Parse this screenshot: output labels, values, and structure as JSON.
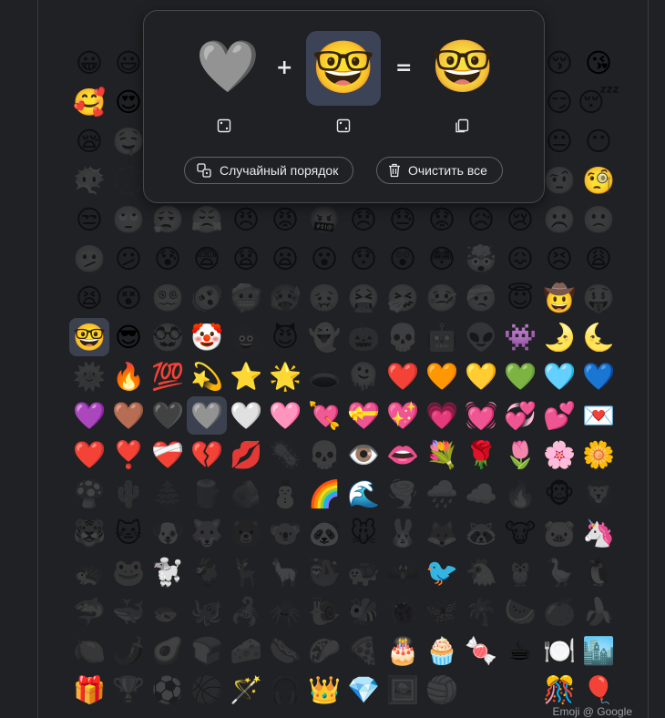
{
  "mixer": {
    "left_emoji": "🩶",
    "right_emoji": "🤓",
    "result_emoji": "🤓",
    "plus": "+",
    "equals": "=",
    "random_order_label": "Случайный порядок",
    "clear_all_label": "Очистить все"
  },
  "credit": "Emoji @ Google",
  "grid": {
    "rows": [
      [
        "😀",
        "😃",
        "😄",
        "😁",
        "😆",
        "😅",
        "😂",
        "🤣",
        "😭",
        "😉",
        "😗",
        "😙",
        "😚",
        "😘"
      ],
      [
        "🥰",
        "😍",
        "🤩",
        "🥳",
        "🫠",
        "🙃",
        "🙂",
        "🥲",
        "🥹",
        "😊",
        "☺️",
        "😌",
        "😏",
        "😴"
      ],
      [
        "😪",
        "🤤",
        "😋",
        "😛",
        "😝",
        "😜",
        "🤪",
        "🥴",
        "😔",
        "🥺",
        "😬",
        "😑",
        "😐",
        "😶"
      ],
      [
        "😶‍🌫️",
        "🫥",
        "🤐",
        "🫡",
        "🤔",
        "🤫",
        "🫢",
        "🤭",
        "🥱",
        "🤗",
        "🫣",
        "😱",
        "🤨",
        "🧐"
      ],
      [
        "😒",
        "🙄",
        "😮‍💨",
        "😤",
        "😠",
        "😡",
        "🤬",
        "😞",
        "😓",
        "😟",
        "😥",
        "😢",
        "☹️",
        "🙁"
      ],
      [
        "🫤",
        "😕",
        "😰",
        "😨",
        "😧",
        "😦",
        "😮",
        "😯",
        "😲",
        "😳",
        "🤯",
        "😖",
        "😣",
        "😩"
      ],
      [
        "😫",
        "😵",
        "😵‍💫",
        "🫨",
        "🥶",
        "🥵",
        "🤢",
        "🤮",
        "🤧",
        "🤒",
        "🤕",
        "😇",
        "🤠",
        "🤑"
      ],
      [
        "🤓",
        "😎",
        "🥸",
        "🤡",
        "💩",
        "😈",
        "👻",
        "🎃",
        "💀",
        "🤖",
        "👽",
        "👾",
        "🌛",
        "🌜"
      ],
      [
        "🌞",
        "🔥",
        "💯",
        "💫",
        "⭐",
        "🌟",
        "🕳️",
        "🫠",
        "❤️",
        "🧡",
        "💛",
        "💚",
        "🩵",
        "💙"
      ],
      [
        "💜",
        "🤎",
        "🖤",
        "🩶",
        "🤍",
        "🩷",
        "💘",
        "💝",
        "💖",
        "💗",
        "💓",
        "💞",
        "💕",
        "💌"
      ],
      [
        "❤️",
        "❣️",
        "❤️‍🩹",
        "💔",
        "💋",
        "🦠",
        "💀",
        "👁️",
        "👄",
        "💐",
        "🌹",
        "🌷",
        "🌸",
        "🌼"
      ],
      [
        "🍄",
        "🌵",
        "🌲",
        "🪵",
        "🪨",
        "⛄",
        "🌈",
        "🌊",
        "🌪️",
        "🌧️",
        "☁️",
        "🔥",
        "🐵",
        "🦁"
      ],
      [
        "🐯",
        "🐱",
        "🐶",
        "🐺",
        "🐻",
        "🐨",
        "🐼",
        "🐭",
        "🐰",
        "🦊",
        "🦝",
        "🐮",
        "🐷",
        "🦄"
      ],
      [
        "🦔",
        "🐸",
        "🐩",
        "🐐",
        "🦌",
        "🦙",
        "🦥",
        "🐢",
        "🦇",
        "🐦",
        "🐔",
        "🦉",
        "🪿",
        "🐧"
      ],
      [
        "🦈",
        "🐳",
        "🐟",
        "🐙",
        "🦂",
        "🕷️",
        "🐌",
        "🐝",
        "🐞",
        "🦋",
        "🌴",
        "🍉",
        "🍊",
        "🍌"
      ],
      [
        "🍋",
        "🌶️",
        "🥑",
        "🍞",
        "🧀",
        "🌭",
        "🌮",
        "🍕",
        "🎂",
        "🧁",
        "🍬",
        "☕",
        "🍽️",
        "🏙️"
      ],
      [
        "🎁",
        "🏆",
        "⚽",
        "🏀",
        "🪄",
        "🎧",
        "👑",
        "💎",
        "🖼️",
        "🏐",
        "",
        "",
        "🎊",
        "🎈"
      ]
    ],
    "bright": [
      [
        0,
        13
      ],
      [
        1,
        0
      ],
      [
        1,
        1
      ],
      [
        3,
        13
      ],
      [
        6,
        12
      ],
      [
        7,
        0
      ],
      [
        7,
        1
      ],
      [
        7,
        3
      ],
      [
        7,
        11
      ],
      [
        7,
        12
      ],
      [
        7,
        13
      ],
      [
        8,
        1
      ],
      [
        8,
        2
      ],
      [
        8,
        3
      ],
      [
        8,
        4
      ],
      [
        8,
        5
      ],
      [
        8,
        8
      ],
      [
        8,
        9
      ],
      [
        8,
        10
      ],
      [
        8,
        11
      ],
      [
        8,
        12
      ],
      [
        8,
        13
      ],
      [
        9,
        0
      ],
      [
        9,
        1
      ],
      [
        9,
        2
      ],
      [
        9,
        3
      ],
      [
        9,
        4
      ],
      [
        9,
        5
      ],
      [
        9,
        6
      ],
      [
        9,
        7
      ],
      [
        9,
        8
      ],
      [
        9,
        9
      ],
      [
        9,
        10
      ],
      [
        9,
        11
      ],
      [
        9,
        12
      ],
      [
        9,
        13
      ],
      [
        10,
        0
      ],
      [
        10,
        1
      ],
      [
        10,
        2
      ],
      [
        10,
        3
      ],
      [
        10,
        4
      ],
      [
        10,
        7
      ],
      [
        10,
        8
      ],
      [
        10,
        9
      ],
      [
        10,
        10
      ],
      [
        10,
        11
      ],
      [
        10,
        12
      ],
      [
        10,
        13
      ],
      [
        11,
        6
      ],
      [
        11,
        7
      ],
      [
        12,
        13
      ],
      [
        13,
        2
      ],
      [
        13,
        9
      ],
      [
        15,
        8
      ],
      [
        15,
        9
      ],
      [
        15,
        10
      ],
      [
        15,
        11
      ],
      [
        15,
        12
      ],
      [
        15,
        13
      ],
      [
        16,
        0
      ],
      [
        16,
        4
      ],
      [
        16,
        6
      ],
      [
        16,
        7
      ],
      [
        16,
        12
      ],
      [
        16,
        13
      ]
    ],
    "selected": [
      [
        7,
        0
      ],
      [
        9,
        3
      ]
    ],
    "dashed": [
      [
        3,
        1
      ]
    ],
    "hole_dark": [
      [
        8,
        6
      ]
    ]
  }
}
